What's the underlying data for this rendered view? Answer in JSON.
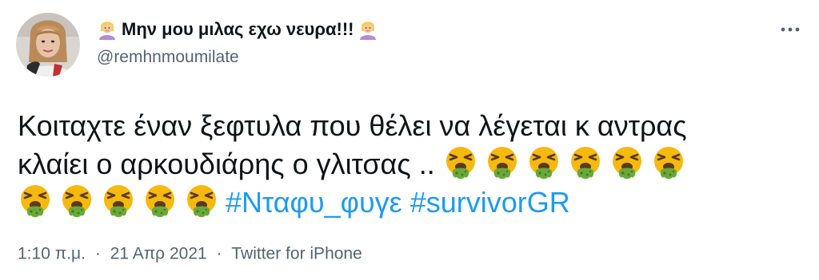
{
  "author": {
    "display_name": "Μην μου μιλας εχω νευρα!!!",
    "handle": "@remhnmoumilate",
    "name_emoji": "person-blond-hair-emoji"
  },
  "tweet": {
    "line1": "Κοιταχτε έναν ξεφτυλα που θέλει να λέγεται κ αντρας",
    "line2_text": "κλαίει ο αρκουδιάρης ο γλιτσας .. ",
    "line2_emojis": [
      "face-vomiting-emoji",
      "face-vomiting-emoji",
      "face-vomiting-emoji",
      "face-vomiting-emoji",
      "face-vomiting-emoji",
      "face-vomiting-emoji"
    ],
    "line3_emojis": [
      "face-vomiting-emoji",
      "face-vomiting-emoji",
      "face-vomiting-emoji",
      "face-vomiting-emoji",
      "face-vomiting-emoji"
    ],
    "hashtags": [
      "#Νταφυ_φυγε",
      "#survivorGR"
    ]
  },
  "footer": {
    "time": "1:10 π.μ.",
    "separator": "·",
    "date": "21 Απρ 2021",
    "source": "Twitter for iPhone"
  },
  "colors": {
    "text": "#0f1419",
    "secondary": "#536471",
    "link": "#1d9bf0",
    "emoji_face": "#f5b90f",
    "emoji_vomit": "#6aa83a"
  },
  "icons": {
    "more": "more-horizontal-icon"
  }
}
